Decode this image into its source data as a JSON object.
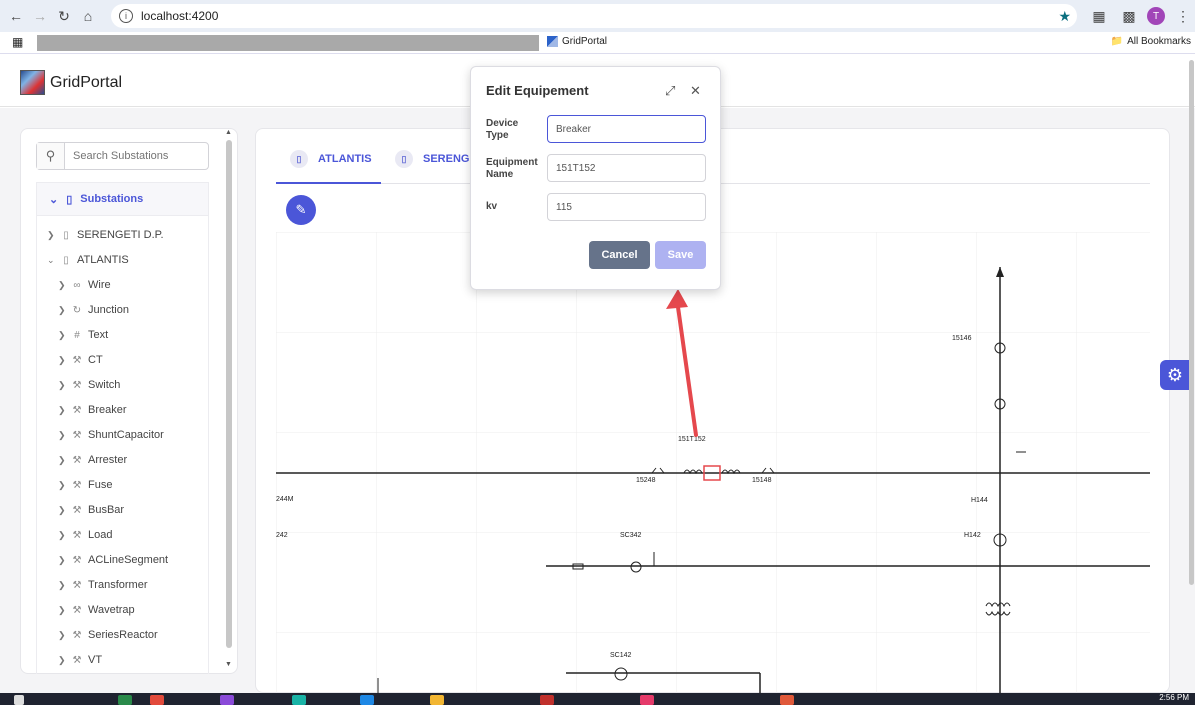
{
  "browser": {
    "url": "localhost:4200",
    "bookmark_label": "GridPortal",
    "all_bookmarks": "All Bookmarks",
    "profile_initial": "T"
  },
  "app": {
    "title": "GridPortal"
  },
  "sidebar": {
    "search_placeholder": "Search Substations",
    "root_label": "Substations",
    "substations": [
      {
        "label": "SERENGETI D.P."
      },
      {
        "label": "ATLANTIS"
      }
    ],
    "atlantis_children": [
      {
        "label": "Wire",
        "icon": "link-icon"
      },
      {
        "label": "Junction",
        "icon": "refresh-icon"
      },
      {
        "label": "Text",
        "icon": "hash-icon"
      },
      {
        "label": "CT",
        "icon": "wrench-icon"
      },
      {
        "label": "Switch",
        "icon": "wrench-icon"
      },
      {
        "label": "Breaker",
        "icon": "wrench-icon"
      },
      {
        "label": "ShuntCapacitor",
        "icon": "wrench-icon"
      },
      {
        "label": "Arrester",
        "icon": "wrench-icon"
      },
      {
        "label": "Fuse",
        "icon": "wrench-icon"
      },
      {
        "label": "BusBar",
        "icon": "wrench-icon"
      },
      {
        "label": "Load",
        "icon": "wrench-icon"
      },
      {
        "label": "ACLineSegment",
        "icon": "wrench-icon"
      },
      {
        "label": "Transformer",
        "icon": "wrench-icon"
      },
      {
        "label": "Wavetrap",
        "icon": "wrench-icon"
      },
      {
        "label": "SeriesReactor",
        "icon": "wrench-icon"
      },
      {
        "label": "VT",
        "icon": "wrench-icon"
      }
    ]
  },
  "tabs": [
    {
      "label": "ATLANTIS",
      "active": true
    },
    {
      "label": "SERENGE"
    }
  ],
  "modal": {
    "title": "Edit Equipement",
    "fields": {
      "device_type_label": "Device Type",
      "device_type_value": "Breaker",
      "equipment_name_label": "Equipment Name",
      "equipment_name_value": "151T152",
      "kv_label": "kv",
      "kv_value": "115"
    },
    "cancel_label": "Cancel",
    "save_label": "Save"
  },
  "diagram": {
    "labels": {
      "l_15146": "15146",
      "l_151t": "151T152",
      "l_15248": "15248",
      "l_15148": "15148",
      "l_h144": "H144",
      "l_h142": "H142",
      "l_sc342": "SC342",
      "l_sc142": "SC142",
      "l_244m": "244M",
      "l_242": "242"
    }
  },
  "taskbar": {
    "time": "2:56 PM"
  },
  "colors": {
    "accent": "#4b56d8",
    "annotation_red": "#e5484d"
  }
}
